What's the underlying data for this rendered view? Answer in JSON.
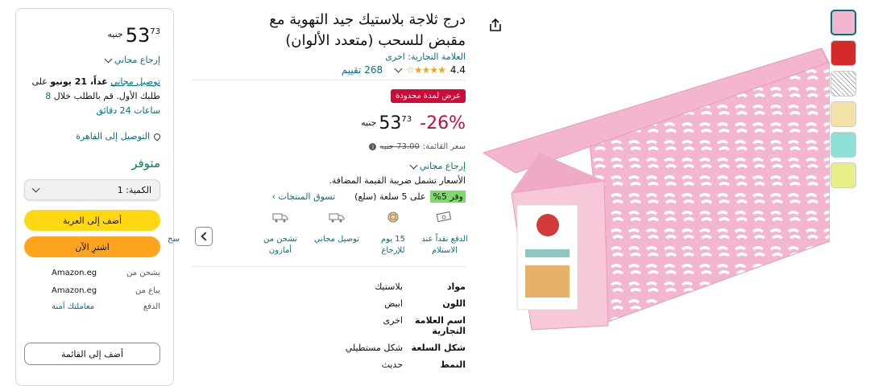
{
  "buybox": {
    "currency": "جنيه",
    "price_whole": "53",
    "price_fraction": "73",
    "free_returns": "إرجاع مجاني",
    "delivery_link": "توصيل مجاني",
    "delivery_rest": "غداً، 21 يونيو",
    "delivery_suffix": "على طلبك الأول. قم بالطلب خلال",
    "delivery_time": "8 ساعات 24 دقائق",
    "location": "التوصيل إلى القاهرة",
    "stock": "متوفر",
    "qty_label": "الكمية:",
    "qty_value": "1",
    "add_to_cart": "أضف إلى العربة",
    "buy_now": "اشترِ الآن",
    "ships_from_label": "يشحن من",
    "ships_from_value": "Amazon.eg",
    "sold_by_label": "يباع من",
    "sold_by_value": "Amazon.eg",
    "payment_label": "الدفع",
    "payment_value": "معاملتك آمنة",
    "add_to_list": "أضف إلى القائمة"
  },
  "product": {
    "title": "درج ثلاجة بلاستيك جيد التهوية مع مقبض للسحب (متعدد الألوان)",
    "brand": "العلامة التجارية: اخرى",
    "rating_value": "4.4",
    "stars": "★★★★☆",
    "rating_count": "268 تقييم",
    "deal_badge": "عرض لمدة محدودة",
    "discount": "-26%",
    "currency": "جنيه",
    "price_whole": "53",
    "price_fraction": "73",
    "list_price_label": "سعر القائمة:",
    "list_price_value": "73.00 جنيه",
    "free_returns": "إرجاع مجاني",
    "vat_note": "الأسعار تشمل ضريبة القيمة المضافة.",
    "promo_tag": "وفر 5%",
    "promo_text": "على 5 سلعة (سلع)",
    "promo_link": "تسوق المنتجات ›"
  },
  "features": [
    {
      "label": "الدفع نقداً عند الاستلام",
      "icon": "cash-on-delivery-icon"
    },
    {
      "label": "15 يوم للإرجاع",
      "icon": "return-icon"
    },
    {
      "label": "توصيل مجاني",
      "icon": "free-delivery-icon"
    },
    {
      "label": "تشحن من أمازون",
      "icon": "shipped-by-amazon-icon"
    },
    {
      "label": "سح",
      "icon": "partial-feature-icon"
    }
  ],
  "specs": [
    {
      "key": "مواد",
      "value": "بلاستيك"
    },
    {
      "key": "اللون",
      "value": "ابيض"
    },
    {
      "key": "اسم العلامة التجارية",
      "value": "اخرى"
    },
    {
      "key": "شكل السلعة",
      "value": "شكل مستطيلي"
    },
    {
      "key": "النمط",
      "value": "حديث"
    }
  ],
  "colors": {
    "link": "#007185",
    "deal": "#cc0c39",
    "cart": "#ffd814",
    "buy": "#ffa41c",
    "stock": "#067d62",
    "basket": "#f4b6cf"
  }
}
